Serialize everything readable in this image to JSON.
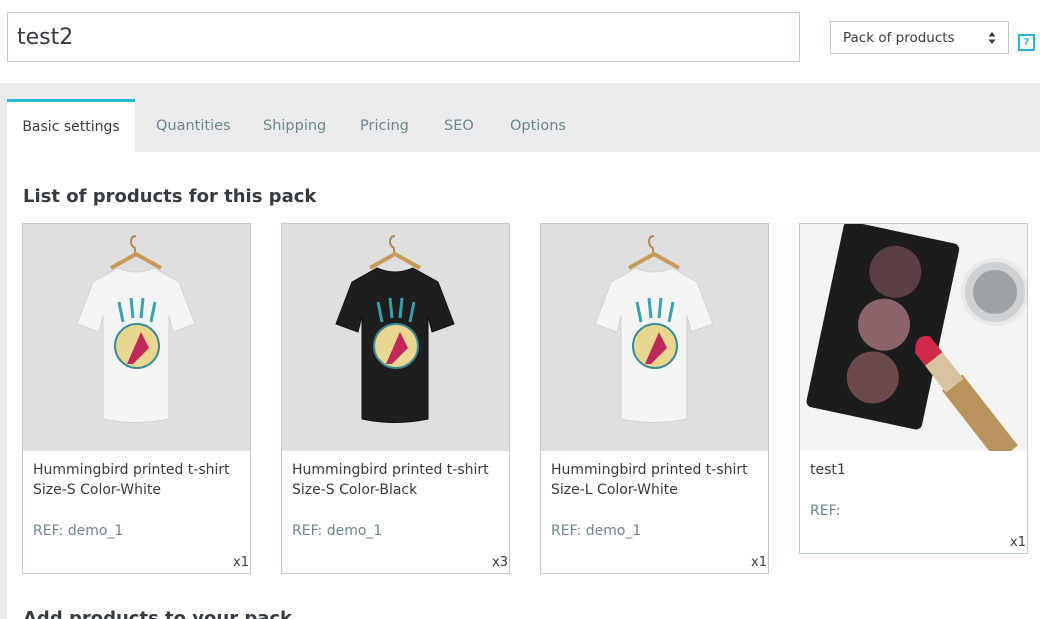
{
  "product": {
    "name_value": "test2",
    "type_selected": "Pack of products"
  },
  "help": {
    "label": "?"
  },
  "tabs": [
    {
      "label": "Basic settings",
      "active": true
    },
    {
      "label": "Quantities"
    },
    {
      "label": "Shipping"
    },
    {
      "label": "Pricing"
    },
    {
      "label": "SEO"
    },
    {
      "label": "Options"
    }
  ],
  "pack": {
    "title": "List of products for this pack",
    "items": [
      {
        "name": "Hummingbird printed t-shirt Size-S Color-White",
        "ref": "REF: demo_1",
        "qty": "x1",
        "image": "white-tshirt"
      },
      {
        "name": "Hummingbird printed t-shirt Size-S Color-Black",
        "ref": "REF: demo_1",
        "qty": "x3",
        "image": "black-tshirt"
      },
      {
        "name": "Hummingbird printed t-shirt Size-L Color-White",
        "ref": "REF: demo_1",
        "qty": "x1",
        "image": "white-tshirt"
      },
      {
        "name": "test1",
        "ref": "REF:",
        "qty": "x1",
        "image": "makeup-palette"
      }
    ]
  },
  "next_section_title": "Add products to your pack"
}
